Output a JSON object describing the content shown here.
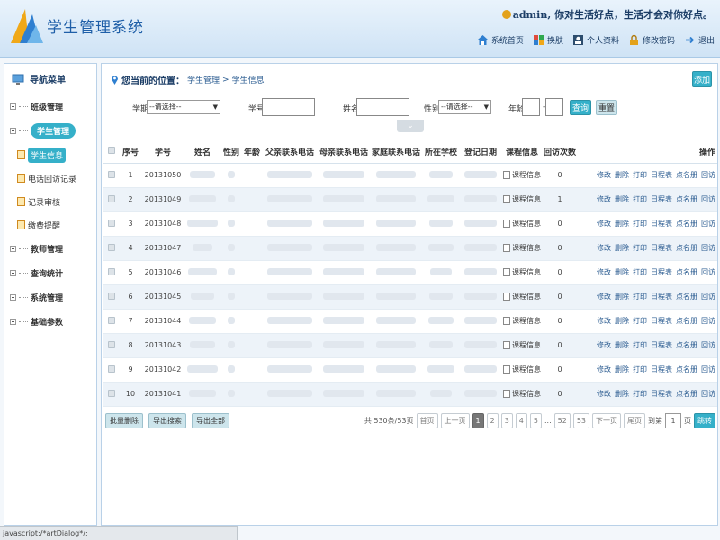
{
  "header": {
    "title": "学生管理系统",
    "user": "admin",
    "motto": "你对生活好点，生活才会对你好点。",
    "nav": [
      {
        "label": "系统首页",
        "icon": "home-icon"
      },
      {
        "label": "换肤",
        "icon": "skin-icon"
      },
      {
        "label": "个人资料",
        "icon": "profile-icon"
      },
      {
        "label": "修改密码",
        "icon": "lock-icon"
      },
      {
        "label": "退出",
        "icon": "exit-icon"
      }
    ]
  },
  "sidebar": {
    "title": "导航菜单",
    "groups": [
      {
        "label": "班级管理",
        "expanded": false,
        "active": false,
        "items": []
      },
      {
        "label": "学生管理",
        "expanded": true,
        "active": true,
        "items": [
          {
            "label": "学生信息",
            "active": true
          },
          {
            "label": "电话回访记录",
            "active": false
          },
          {
            "label": "记录审核",
            "active": false
          },
          {
            "label": "缴费提醒",
            "active": false
          }
        ]
      },
      {
        "label": "教师管理",
        "expanded": false,
        "active": false,
        "items": []
      },
      {
        "label": "查询统计",
        "expanded": false,
        "active": false,
        "items": []
      },
      {
        "label": "系统管理",
        "expanded": false,
        "active": false,
        "items": []
      },
      {
        "label": "基础参数",
        "expanded": false,
        "active": false,
        "items": []
      }
    ]
  },
  "breadcrumb": {
    "prefix": "您当前的位置：",
    "section": "学生管理",
    "separator": ">",
    "page": "学生信息"
  },
  "toolbar": {
    "add_label": "添加"
  },
  "filters": {
    "term_label": "学期",
    "term_value": "--请选择--",
    "student_no_label": "学号",
    "name_label": "姓名",
    "gender_label": "性别",
    "gender_value": "--请选择--",
    "age_label": "年龄",
    "age_sep": "-",
    "search_label": "查询",
    "reset_label": "重置"
  },
  "table": {
    "columns": [
      "序号",
      "学号",
      "姓名",
      "性别",
      "年龄",
      "父亲联系电话",
      "母亲联系电话",
      "家庭联系电话",
      "所在学校",
      "登记日期",
      "课程信息",
      "回访次数",
      "操作"
    ],
    "course_label": "课程信息",
    "operations": [
      "修改",
      "删除",
      "打印",
      "日程表",
      "点名册",
      "回访"
    ],
    "rows": [
      {
        "index": "1",
        "student_no": "20131050",
        "visits": "0"
      },
      {
        "index": "2",
        "student_no": "20131049",
        "visits": "1"
      },
      {
        "index": "3",
        "student_no": "20131048",
        "visits": "0"
      },
      {
        "index": "4",
        "student_no": "20131047",
        "visits": "0"
      },
      {
        "index": "5",
        "student_no": "20131046",
        "visits": "0"
      },
      {
        "index": "6",
        "student_no": "20131045",
        "visits": "0"
      },
      {
        "index": "7",
        "student_no": "20131044",
        "visits": "0"
      },
      {
        "index": "8",
        "student_no": "20131043",
        "visits": "0"
      },
      {
        "index": "9",
        "student_no": "20131042",
        "visits": "0"
      },
      {
        "index": "10",
        "student_no": "20131041",
        "visits": "0"
      }
    ]
  },
  "bulk_actions": [
    "批量删除",
    "导出搜索",
    "导出全部"
  ],
  "pagination": {
    "summary": "共 530条/53页",
    "first": "首页",
    "prev": "上一页",
    "pages": [
      "1",
      "2",
      "3",
      "4",
      "5"
    ],
    "ellipsis": "...",
    "tail_pages": [
      "52",
      "53"
    ],
    "next": "下一页",
    "last": "尾页",
    "jump_prefix": "到第",
    "jump_value": "1",
    "jump_suffix": "页",
    "go_label": "跳转",
    "current": "1"
  },
  "statusbar": {
    "text": "javascript:/*artDialog*/;"
  },
  "colors": {
    "accent": "#35b0c9",
    "title": "#1f5fa8",
    "header_bg": "#cfe3f5"
  }
}
